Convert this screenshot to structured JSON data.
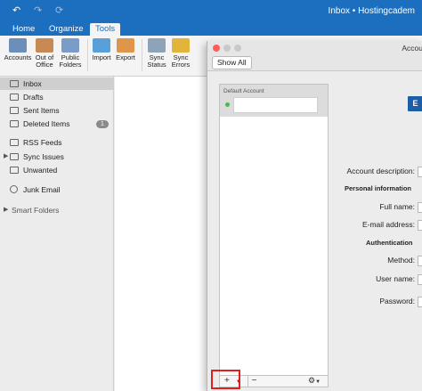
{
  "window": {
    "title": "Inbox • Hostingcadem",
    "qat": [
      {
        "icon": "undo-icon",
        "glyph": "↶"
      },
      {
        "icon": "redo-icon",
        "glyph": "↷"
      },
      {
        "icon": "sync-icon",
        "glyph": "⟳"
      }
    ]
  },
  "ribbon": {
    "tabs": [
      {
        "label": "Home",
        "active": false
      },
      {
        "label": "Organize",
        "active": false
      },
      {
        "label": "Tools",
        "active": true
      }
    ],
    "buttons": [
      {
        "label": "Accounts",
        "icon": "accounts-icon",
        "color": "#6b8fb8"
      },
      {
        "label": "Out of Office",
        "icon": "out-of-office-icon",
        "color": "#c88a54"
      },
      {
        "label": "Public Folders",
        "icon": "public-folders-icon",
        "color": "#7a9cc6"
      },
      {
        "label": "Import",
        "icon": "import-icon",
        "color": "#5aa0d8"
      },
      {
        "label": "Export",
        "icon": "export-icon",
        "color": "#e0964a"
      },
      {
        "label": "Sync Status",
        "icon": "sync-status-icon",
        "color": "#8ca3b8"
      },
      {
        "label": "Sync Errors",
        "icon": "sync-errors-icon",
        "color": "#e3b43c"
      }
    ]
  },
  "sidebar": {
    "items": [
      {
        "label": "Inbox",
        "selected": true,
        "icon": "inbox-icon"
      },
      {
        "label": "Drafts",
        "icon": "drafts-icon"
      },
      {
        "label": "Sent Items",
        "icon": "sent-items-icon"
      },
      {
        "label": "Deleted Items",
        "icon": "deleted-items-icon",
        "badge": "1"
      },
      {
        "label": "RSS Feeds",
        "icon": "folder-icon"
      },
      {
        "label": "Sync Issues",
        "icon": "folder-icon",
        "expandable": true
      },
      {
        "label": "Unwanted",
        "icon": "folder-icon"
      },
      {
        "label": "Junk Email",
        "icon": "junk-icon"
      },
      {
        "label": "Smart Folders",
        "header": true
      }
    ]
  },
  "dialog": {
    "title": "Accou",
    "show_all": "Show All",
    "group_label": "Default Account",
    "add_button": "+",
    "remove_button": "−",
    "gear_button": "⚙",
    "logo_letter": "E",
    "fields": [
      {
        "label": "Account description:"
      },
      {
        "section": "Personal information"
      },
      {
        "label": "Full name:"
      },
      {
        "label": "E-mail address:"
      },
      {
        "section": "Authentication"
      },
      {
        "label": "Method:"
      },
      {
        "label": "User name:"
      },
      {
        "label": "Password:"
      }
    ]
  }
}
